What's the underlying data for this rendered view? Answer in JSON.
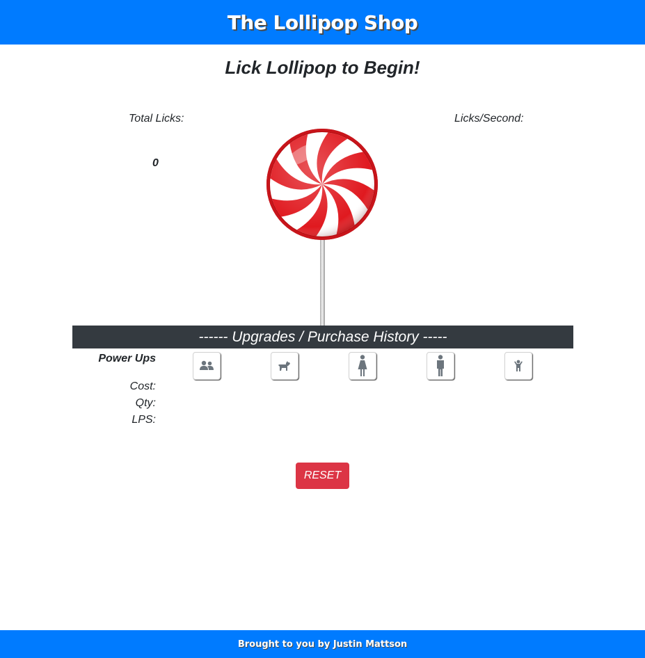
{
  "header": {
    "title": "The Lollipop Shop"
  },
  "main": {
    "subtitle": "Lick Lollipop to Begin!",
    "total_licks_label": "Total Licks:",
    "total_licks_value": "0",
    "licks_per_second_label": "Licks/Second:",
    "lollipop_icon": "lollipop-icon"
  },
  "upgrades": {
    "bar_title": "------ Upgrades / Purchase History -----",
    "powerups_label": "Power Ups",
    "cost_label": "Cost:",
    "qty_label": "Qty:",
    "lps_label": "LPS:",
    "items": [
      {
        "icon": "users-icon"
      },
      {
        "icon": "dog-icon"
      },
      {
        "icon": "female-icon"
      },
      {
        "icon": "male-icon"
      },
      {
        "icon": "child-icon"
      }
    ]
  },
  "controls": {
    "reset_label": "RESET"
  },
  "footer": {
    "text": "Brought to you by Justin Mattson"
  },
  "colors": {
    "header_bg": "#007bff",
    "upgrades_bar_bg": "#343a40",
    "reset_bg": "#dc3545",
    "candy_red": "#e0191f",
    "icon_gray": "#6c757d"
  }
}
